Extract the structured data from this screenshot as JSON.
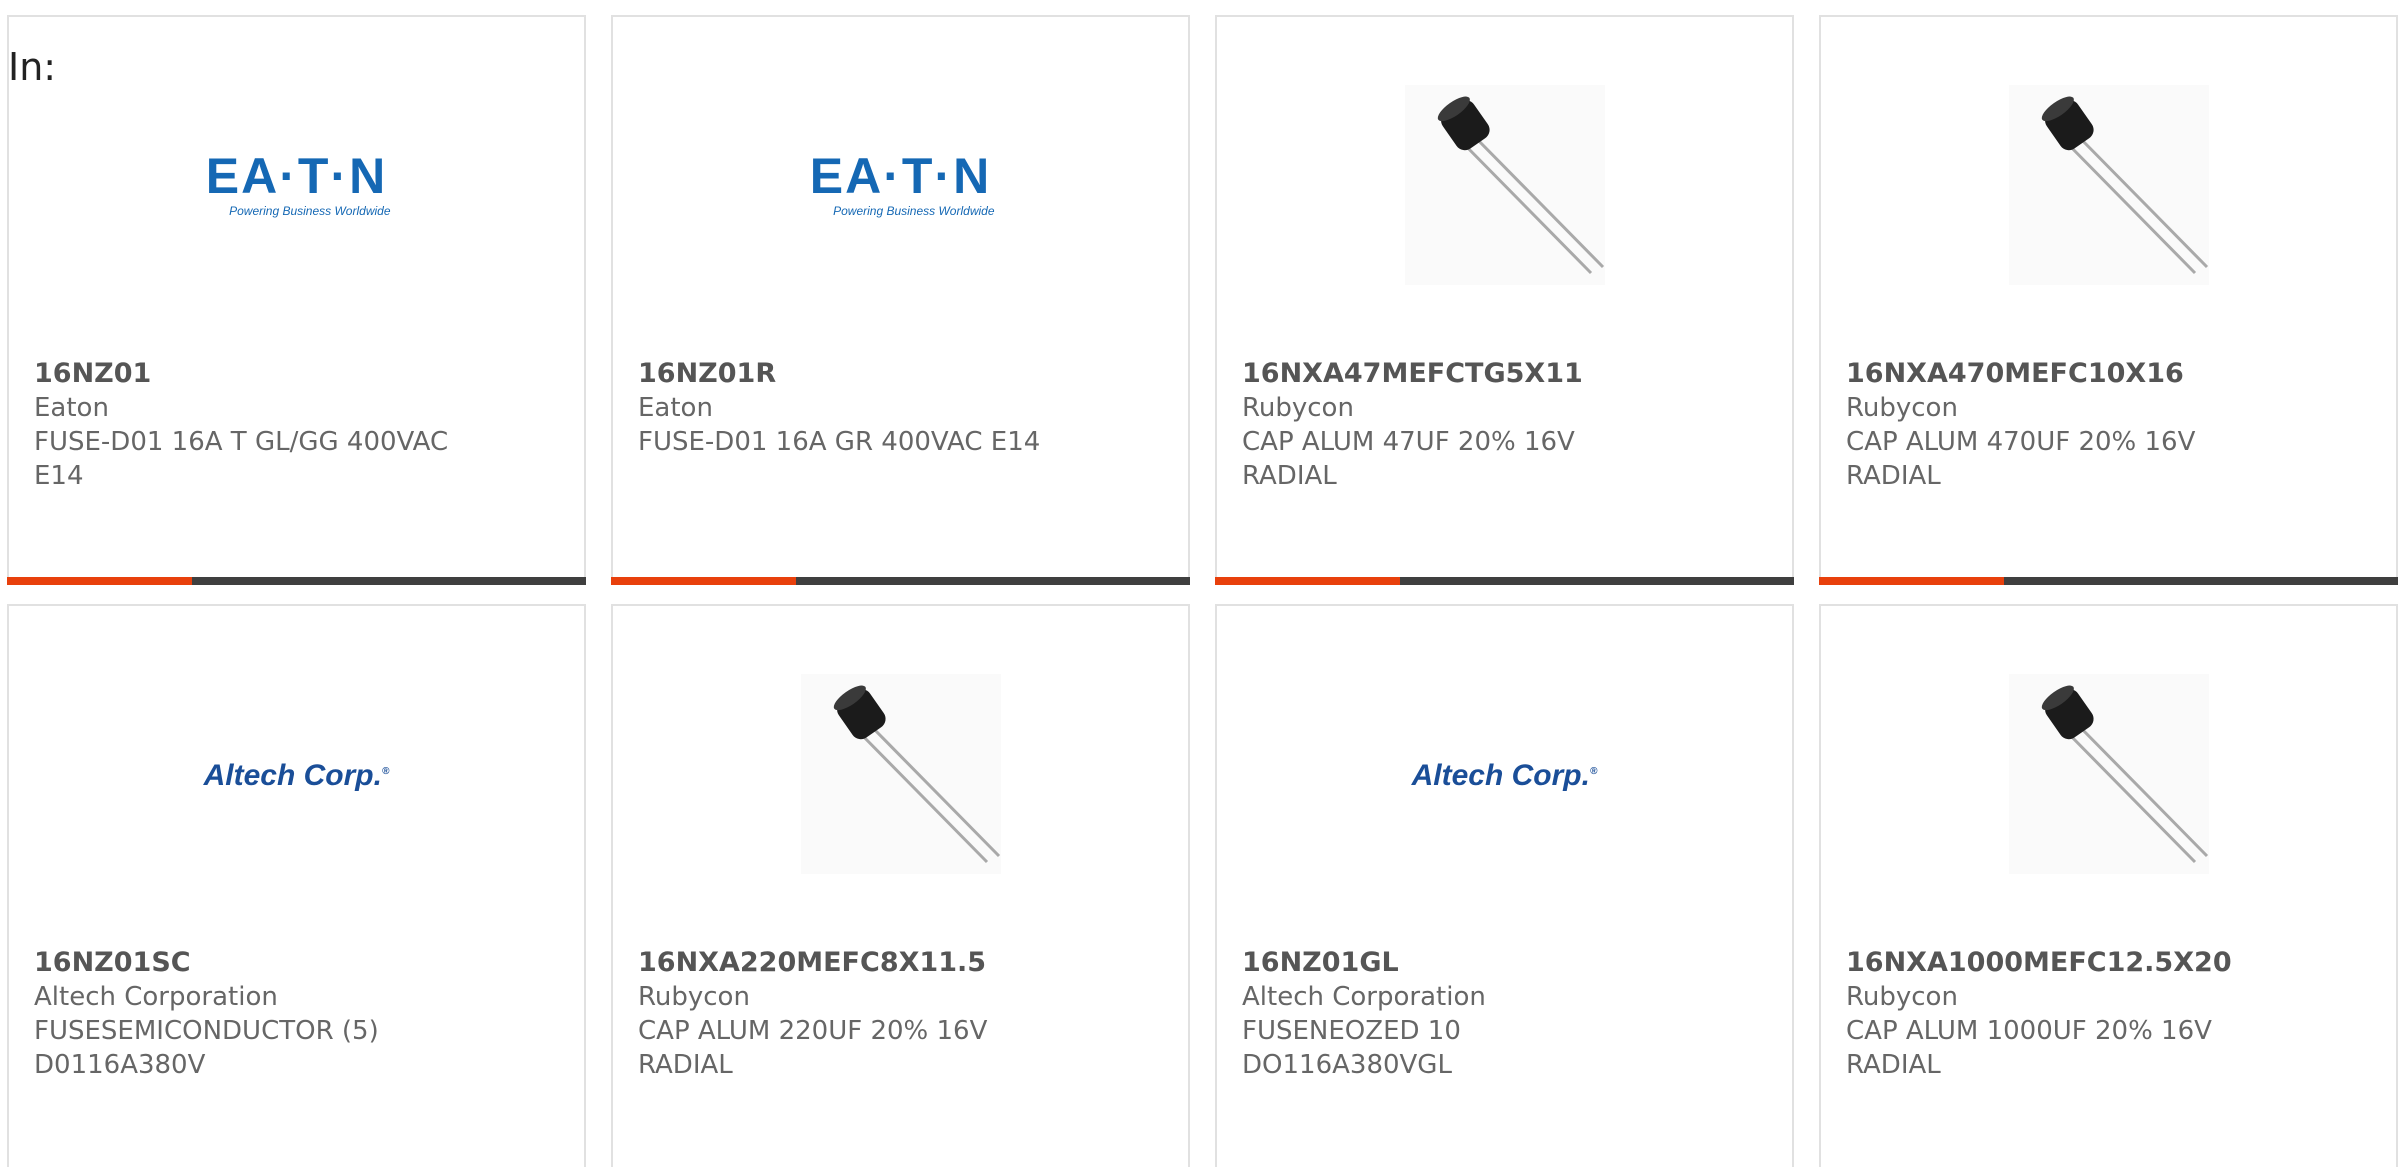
{
  "header": {
    "in_label": "In:"
  },
  "accent_color": "#e8400c",
  "bar_color": "#3f3f3f",
  "products": [
    {
      "part_number": "16NZ01",
      "manufacturer": "Eaton",
      "description": "FUSE-D01 16A T GL/GG 400VAC E14",
      "image": "eaton-logo",
      "logo_text": "EA·T·N",
      "logo_tagline": "Powering Business Worldwide"
    },
    {
      "part_number": "16NZ01R",
      "manufacturer": "Eaton",
      "description": "FUSE-D01 16A GR 400VAC E14",
      "image": "eaton-logo",
      "logo_text": "EA·T·N",
      "logo_tagline": "Powering Business Worldwide"
    },
    {
      "part_number": "16NXA47MEFCTG5X11",
      "manufacturer": "Rubycon",
      "description": "CAP ALUM 47UF 20% 16V RADIAL",
      "image": "capacitor-image"
    },
    {
      "part_number": "16NXA470MEFC10X16",
      "manufacturer": "Rubycon",
      "description": "CAP ALUM 470UF 20% 16V RADIAL",
      "image": "capacitor-image"
    },
    {
      "part_number": "16NZ01SC",
      "manufacturer": "Altech Corporation",
      "description": "FUSESEMICONDUCTOR (5) D0116A380V",
      "image": "altech-logo",
      "logo_text": "Altech Corp."
    },
    {
      "part_number": "16NXA220MEFC8X11.5",
      "manufacturer": "Rubycon",
      "description": "CAP ALUM 220UF 20% 16V RADIAL",
      "image": "capacitor-image"
    },
    {
      "part_number": "16NZ01GL",
      "manufacturer": "Altech Corporation",
      "description": "FUSENEOZED 10 DO116A380VGL",
      "image": "altech-logo",
      "logo_text": "Altech Corp."
    },
    {
      "part_number": "16NXA1000MEFC12.5X20",
      "manufacturer": "Rubycon",
      "description": "CAP ALUM 1000UF 20% 16V RADIAL",
      "image": "capacitor-image"
    }
  ],
  "card_progress": [
    0.32,
    0.32,
    0.32,
    0.32
  ]
}
